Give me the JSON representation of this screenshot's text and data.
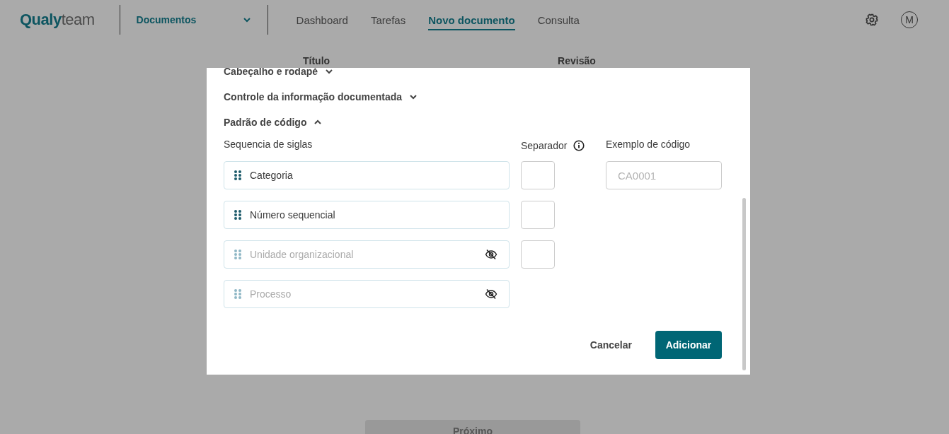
{
  "header": {
    "logo": {
      "part_1": "Qualy",
      "part_2": "team"
    },
    "module_select": {
      "value": "Documentos"
    },
    "nav": [
      {
        "label": "Dashboard",
        "selected": false
      },
      {
        "label": "Tarefas",
        "selected": false
      },
      {
        "label": "Novo documento",
        "selected": true
      },
      {
        "label": "Consulta",
        "selected": false
      }
    ],
    "avatar": "M"
  },
  "background_form": {
    "labels": [
      "Título",
      "Revisão"
    ],
    "next_button": "Próximo"
  },
  "modal": {
    "sections": [
      {
        "title": "Cabeçalho e rodapé",
        "expanded": false
      },
      {
        "title": "Controle da informação documentada",
        "expanded": false
      },
      {
        "title": "Padrão de código",
        "expanded": true
      }
    ],
    "sequence_label": "Sequencia de siglas",
    "items": [
      {
        "label": "Categoria",
        "visible": true,
        "separator": true
      },
      {
        "label": "Número sequencial",
        "visible": true,
        "separator": true
      },
      {
        "label": "Unidade organizacional",
        "visible": false,
        "separator": true
      },
      {
        "label": "Processo",
        "visible": false,
        "separator": false
      }
    ],
    "separator_label": "Separador",
    "example": {
      "label": "Exemplo de código",
      "placeholder": "CA0001"
    },
    "cancel_button": "Cancelar",
    "add_button": "Adicionar"
  }
}
